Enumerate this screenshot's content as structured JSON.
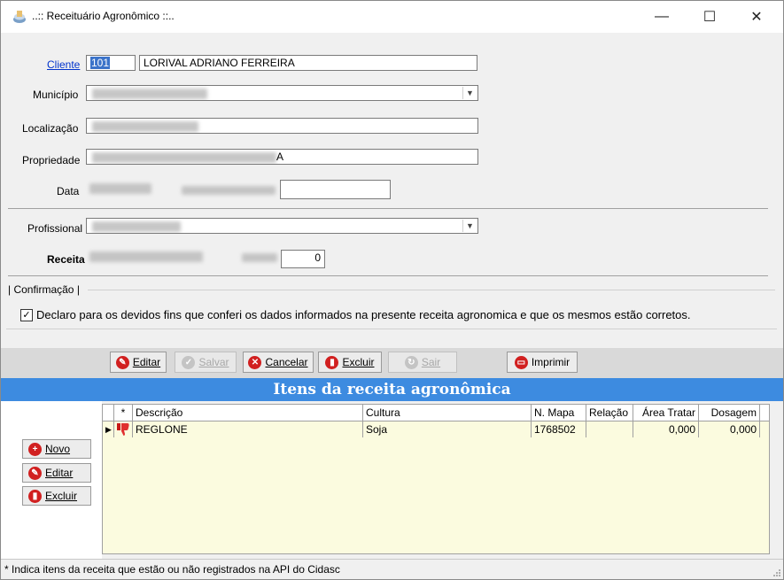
{
  "window": {
    "title": "..:: Receituário Agronômico ::..",
    "minimize": "—",
    "maximize": "☐",
    "close": "✕"
  },
  "form": {
    "cliente_label": "Cliente",
    "cliente_code": "101",
    "cliente_name": "LORIVAL ADRIANO FERREIRA",
    "municipio_label": "Município",
    "localizacao_label": "Localização",
    "propriedade_label": "Propriedade",
    "propriedade_suffix": "A",
    "data_label": "Data",
    "profissional_label": "Profissional",
    "receita_label": "Receita",
    "number_value": "0"
  },
  "confirmacao": {
    "group_label": "| Confirmação |",
    "checked": true,
    "text": "Declaro para os devidos fins que conferi os dados informados na presente receita agronomica e que os mesmos estão corretos."
  },
  "toolbar": {
    "editar": "Editar",
    "salvar": "Salvar",
    "cancelar": "Cancelar",
    "excluir": "Excluir",
    "sair": "Sair",
    "imprimir": "Imprimir"
  },
  "itens": {
    "header": "Itens da receita agronômica",
    "novo": "Novo",
    "editar": "Editar",
    "excluir": "Excluir",
    "columns": [
      "*",
      "Descrição",
      "Cultura",
      "N. Mapa",
      "Relação",
      "Área Tratar",
      "Dosagem"
    ],
    "rows": [
      {
        "descricao": "REGLONE",
        "cultura": "Soja",
        "mapa": "1768502",
        "relacao": "",
        "area": "0,000",
        "dosagem": "0,000"
      }
    ]
  },
  "status": {
    "text": "* Indica itens da receita que estão ou não registrados na API do Cidasc"
  },
  "colors": {
    "header_blue": "#3d8be0",
    "grid_yellow": "#fbfbdf",
    "link_blue": "#0033cc",
    "button_red": "#d12020"
  }
}
